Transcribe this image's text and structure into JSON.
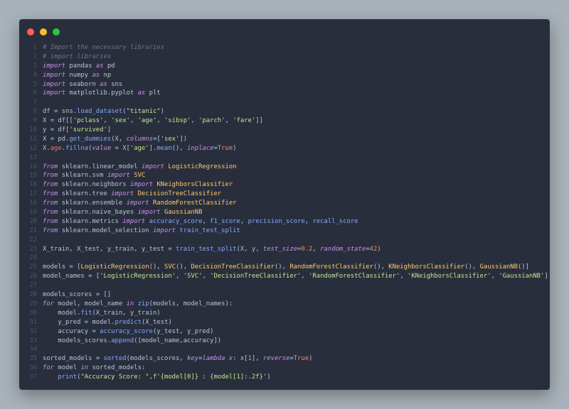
{
  "window": {
    "controls": [
      {
        "name": "close-button",
        "color": "#ff5f57"
      },
      {
        "name": "minimize-button",
        "color": "#febc2e"
      },
      {
        "name": "maximize-button",
        "color": "#28c840"
      }
    ]
  },
  "code_lines": [
    {
      "n": "1",
      "tokens": [
        [
          "c",
          "# Import the necessary libraries"
        ]
      ]
    },
    {
      "n": "2",
      "tokens": [
        [
          "c",
          "# import libraries"
        ]
      ]
    },
    {
      "n": "3",
      "tokens": [
        [
          "k",
          "import"
        ],
        [
          "t",
          " pandas "
        ],
        [
          "k",
          "as"
        ],
        [
          "t",
          " pd"
        ]
      ]
    },
    {
      "n": "4",
      "tokens": [
        [
          "k",
          "import"
        ],
        [
          "t",
          " numpy "
        ],
        [
          "k",
          "as"
        ],
        [
          "t",
          " np"
        ]
      ]
    },
    {
      "n": "5",
      "tokens": [
        [
          "k",
          "import"
        ],
        [
          "t",
          " seaborn "
        ],
        [
          "k",
          "as"
        ],
        [
          "t",
          " sns"
        ]
      ]
    },
    {
      "n": "6",
      "tokens": [
        [
          "k",
          "import"
        ],
        [
          "t",
          " matplotlib.pyplot "
        ],
        [
          "k",
          "as"
        ],
        [
          "t",
          " plt"
        ]
      ]
    },
    {
      "n": "7",
      "tokens": []
    },
    {
      "n": "8",
      "tokens": [
        [
          "t",
          "df "
        ],
        [
          "o",
          "="
        ],
        [
          "t",
          " sns."
        ],
        [
          "f",
          "load_dataset"
        ],
        [
          "t",
          "("
        ],
        [
          "s",
          "\"titanic\""
        ],
        [
          "t",
          ")"
        ]
      ]
    },
    {
      "n": "9",
      "tokens": [
        [
          "t",
          "X "
        ],
        [
          "o",
          "="
        ],
        [
          "t",
          " df[["
        ],
        [
          "s",
          "'pclass'"
        ],
        [
          "t",
          ", "
        ],
        [
          "s",
          "'sex'"
        ],
        [
          "t",
          ", "
        ],
        [
          "s",
          "'age'"
        ],
        [
          "t",
          ", "
        ],
        [
          "s",
          "'sibsp'"
        ],
        [
          "t",
          ", "
        ],
        [
          "s",
          "'parch'"
        ],
        [
          "t",
          ", "
        ],
        [
          "s",
          "'fare'"
        ],
        [
          "t",
          "]]"
        ]
      ]
    },
    {
      "n": "10",
      "tokens": [
        [
          "t",
          "y "
        ],
        [
          "o",
          "="
        ],
        [
          "t",
          " df["
        ],
        [
          "s",
          "'survived'"
        ],
        [
          "t",
          "]"
        ]
      ]
    },
    {
      "n": "11",
      "tokens": [
        [
          "t",
          "X "
        ],
        [
          "o",
          "="
        ],
        [
          "t",
          " pd."
        ],
        [
          "f",
          "get_dummies"
        ],
        [
          "t",
          "(X, "
        ],
        [
          "p",
          "columns"
        ],
        [
          "o",
          "="
        ],
        [
          "t",
          "["
        ],
        [
          "s",
          "'sex'"
        ],
        [
          "t",
          "])"
        ]
      ]
    },
    {
      "n": "12",
      "tokens": [
        [
          "t",
          "X."
        ],
        [
          "b",
          "age"
        ],
        [
          "t",
          "."
        ],
        [
          "f",
          "fillna"
        ],
        [
          "t",
          "("
        ],
        [
          "p",
          "value"
        ],
        [
          "t",
          " "
        ],
        [
          "o",
          "="
        ],
        [
          "t",
          " X["
        ],
        [
          "s",
          "'age'"
        ],
        [
          "t",
          "]."
        ],
        [
          "f",
          "mean"
        ],
        [
          "t",
          "(), "
        ],
        [
          "p",
          "inplace"
        ],
        [
          "o",
          "="
        ],
        [
          "n",
          "True"
        ],
        [
          "t",
          ")"
        ]
      ]
    },
    {
      "n": "13",
      "tokens": []
    },
    {
      "n": "14",
      "tokens": [
        [
          "k",
          "from"
        ],
        [
          "t",
          " sklearn.linear_model "
        ],
        [
          "k",
          "import"
        ],
        [
          "t",
          " "
        ],
        [
          "cl",
          "LogisticRegression"
        ]
      ]
    },
    {
      "n": "15",
      "tokens": [
        [
          "k",
          "from"
        ],
        [
          "t",
          " sklearn.svm "
        ],
        [
          "k",
          "import"
        ],
        [
          "t",
          " "
        ],
        [
          "cl",
          "SVC"
        ]
      ]
    },
    {
      "n": "16",
      "tokens": [
        [
          "k",
          "from"
        ],
        [
          "t",
          " sklearn.neighbors "
        ],
        [
          "k",
          "import"
        ],
        [
          "t",
          " "
        ],
        [
          "cl",
          "KNeighborsClassifier"
        ]
      ]
    },
    {
      "n": "17",
      "tokens": [
        [
          "k",
          "from"
        ],
        [
          "t",
          " sklearn.tree "
        ],
        [
          "k",
          "import"
        ],
        [
          "t",
          " "
        ],
        [
          "cl",
          "DecisionTreeClassifier"
        ]
      ]
    },
    {
      "n": "18",
      "tokens": [
        [
          "k",
          "from"
        ],
        [
          "t",
          " sklearn.ensemble "
        ],
        [
          "k",
          "import"
        ],
        [
          "t",
          " "
        ],
        [
          "cl",
          "RandomForestClassifier"
        ]
      ]
    },
    {
      "n": "19",
      "tokens": [
        [
          "k",
          "from"
        ],
        [
          "t",
          " sklearn.naive_bayes "
        ],
        [
          "k",
          "import"
        ],
        [
          "t",
          " "
        ],
        [
          "cl",
          "GaussianNB"
        ]
      ]
    },
    {
      "n": "20",
      "tokens": [
        [
          "k",
          "from"
        ],
        [
          "t",
          " sklearn.metrics "
        ],
        [
          "k",
          "import"
        ],
        [
          "t",
          " "
        ],
        [
          "f",
          "accuracy_score"
        ],
        [
          "t",
          ", "
        ],
        [
          "f",
          "f1_score"
        ],
        [
          "t",
          ", "
        ],
        [
          "f",
          "precision_score"
        ],
        [
          "t",
          ", "
        ],
        [
          "f",
          "recall_score"
        ]
      ]
    },
    {
      "n": "21",
      "tokens": [
        [
          "k",
          "from"
        ],
        [
          "t",
          " sklearn.model_selection "
        ],
        [
          "k",
          "import"
        ],
        [
          "t",
          " "
        ],
        [
          "f",
          "train_test_split"
        ]
      ]
    },
    {
      "n": "22",
      "tokens": []
    },
    {
      "n": "23",
      "tokens": [
        [
          "t",
          "X_train, X_test, y_train, y_test "
        ],
        [
          "o",
          "="
        ],
        [
          "t",
          " "
        ],
        [
          "f",
          "train_test_split"
        ],
        [
          "t",
          "(X, y, "
        ],
        [
          "p",
          "test_size"
        ],
        [
          "o",
          "="
        ],
        [
          "n",
          "0.2"
        ],
        [
          "t",
          ", "
        ],
        [
          "p",
          "random_state"
        ],
        [
          "o",
          "="
        ],
        [
          "n",
          "42"
        ],
        [
          "t",
          ")"
        ]
      ]
    },
    {
      "n": "24",
      "tokens": []
    },
    {
      "n": "25",
      "tokens": [
        [
          "t",
          "models "
        ],
        [
          "o",
          "="
        ],
        [
          "t",
          " ["
        ],
        [
          "cl",
          "LogisticRegression"
        ],
        [
          "t",
          "(), "
        ],
        [
          "cl",
          "SVC"
        ],
        [
          "t",
          "(), "
        ],
        [
          "cl",
          "DecisionTreeClassifier"
        ],
        [
          "t",
          "(), "
        ],
        [
          "cl",
          "RandomForestClassifier"
        ],
        [
          "t",
          "(), "
        ],
        [
          "cl",
          "KNeighborsClassifier"
        ],
        [
          "t",
          "(), "
        ],
        [
          "cl",
          "GaussianNB"
        ],
        [
          "t",
          "()]"
        ]
      ]
    },
    {
      "n": "26",
      "tokens": [
        [
          "t",
          "model_names "
        ],
        [
          "o",
          "="
        ],
        [
          "t",
          " ["
        ],
        [
          "s",
          "'LogisticRegression'"
        ],
        [
          "t",
          ", "
        ],
        [
          "s",
          "'SVC'"
        ],
        [
          "t",
          ", "
        ],
        [
          "s",
          "'DecisionTreeClassifier'"
        ],
        [
          "t",
          ", "
        ],
        [
          "s",
          "'RandomForestClassifier'"
        ],
        [
          "t",
          ", "
        ],
        [
          "s",
          "'KNeighborsClassifier'"
        ],
        [
          "t",
          ", "
        ],
        [
          "s",
          "'GaussianNB'"
        ],
        [
          "t",
          "]"
        ]
      ]
    },
    {
      "n": "27",
      "tokens": []
    },
    {
      "n": "28",
      "tokens": [
        [
          "t",
          "models_scores "
        ],
        [
          "o",
          "="
        ],
        [
          "t",
          " []"
        ]
      ]
    },
    {
      "n": "29",
      "tokens": [
        [
          "k",
          "for"
        ],
        [
          "t",
          " model, model_name "
        ],
        [
          "k",
          "in"
        ],
        [
          "t",
          " "
        ],
        [
          "f",
          "zip"
        ],
        [
          "t",
          "(models, model_names):"
        ]
      ]
    },
    {
      "n": "30",
      "tokens": [
        [
          "t",
          "    model."
        ],
        [
          "f",
          "fit"
        ],
        [
          "t",
          "(X_train, y_train)"
        ]
      ]
    },
    {
      "n": "31",
      "tokens": [
        [
          "t",
          "    y_pred "
        ],
        [
          "o",
          "="
        ],
        [
          "t",
          " model."
        ],
        [
          "f",
          "predict"
        ],
        [
          "t",
          "(X_test)"
        ]
      ]
    },
    {
      "n": "32",
      "tokens": [
        [
          "t",
          "    accuracy "
        ],
        [
          "o",
          "="
        ],
        [
          "t",
          " "
        ],
        [
          "f",
          "accuracy_score"
        ],
        [
          "t",
          "(y_test, y_pred)"
        ]
      ]
    },
    {
      "n": "33",
      "tokens": [
        [
          "t",
          "    models_scores."
        ],
        [
          "f",
          "append"
        ],
        [
          "t",
          "([model_name,accuracy])"
        ]
      ]
    },
    {
      "n": "34",
      "tokens": []
    },
    {
      "n": "35",
      "tokens": [
        [
          "t",
          "sorted_models "
        ],
        [
          "o",
          "="
        ],
        [
          "t",
          " "
        ],
        [
          "f",
          "sorted"
        ],
        [
          "t",
          "(models_scores, "
        ],
        [
          "p",
          "key"
        ],
        [
          "o",
          "="
        ],
        [
          "k",
          "lambda"
        ],
        [
          "t",
          " "
        ],
        [
          "p",
          "x"
        ],
        [
          "t",
          ": x["
        ],
        [
          "n",
          "1"
        ],
        [
          "t",
          "], "
        ],
        [
          "p",
          "reverse"
        ],
        [
          "o",
          "="
        ],
        [
          "n",
          "True"
        ],
        [
          "t",
          ")"
        ]
      ]
    },
    {
      "n": "36",
      "tokens": [
        [
          "k",
          "for"
        ],
        [
          "t",
          " model "
        ],
        [
          "k",
          "in"
        ],
        [
          "t",
          " sorted_models:"
        ]
      ]
    },
    {
      "n": "37",
      "tokens": [
        [
          "t",
          "    "
        ],
        [
          "f",
          "print"
        ],
        [
          "t",
          "("
        ],
        [
          "s",
          "\"Accuracy Score: \""
        ],
        [
          "t",
          ","
        ],
        [
          "s",
          "f'{model[0]} : {model[1]:.2f}'"
        ],
        [
          "t",
          ")"
        ]
      ]
    }
  ]
}
